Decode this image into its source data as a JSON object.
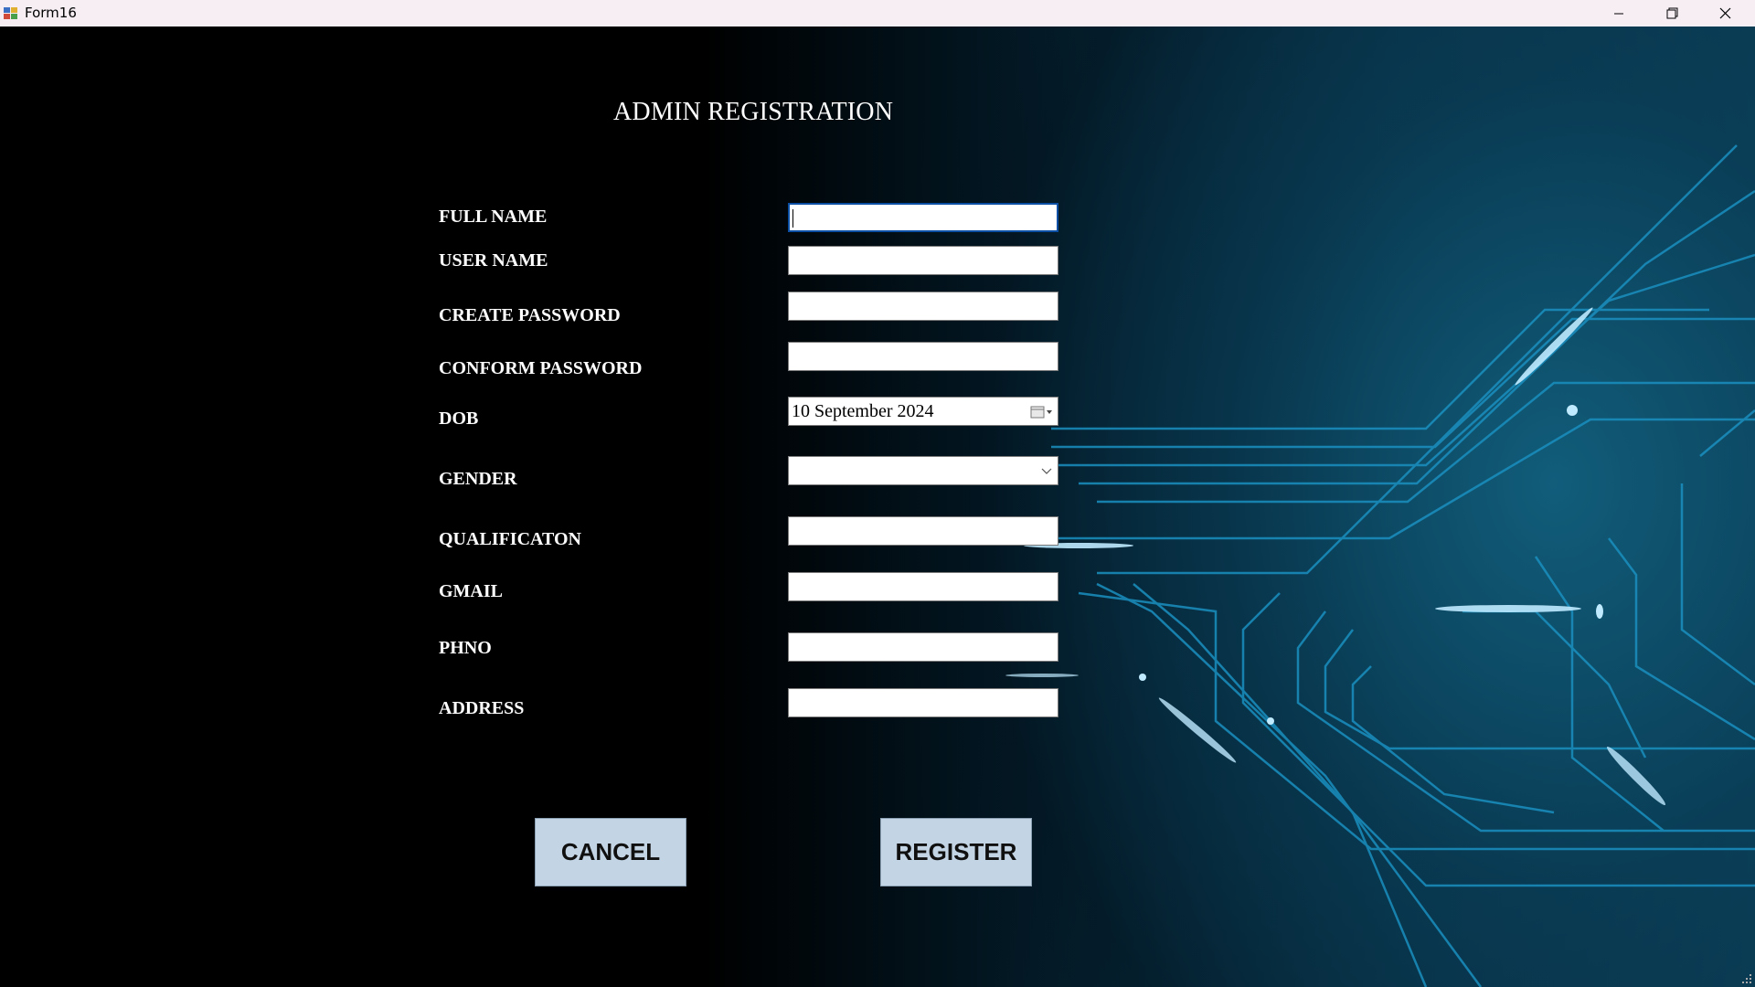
{
  "window": {
    "title": "Form16",
    "icon": "winforms-app-icon",
    "controls": [
      "minimize-icon",
      "restore-icon",
      "close-icon"
    ]
  },
  "form": {
    "heading": "ADMIN REGISTRATION",
    "fields": {
      "full_name": {
        "label": "FULL NAME",
        "value": ""
      },
      "user_name": {
        "label": "USER NAME",
        "value": ""
      },
      "create_password": {
        "label": "CREATE PASSWORD",
        "value": ""
      },
      "confirm_password": {
        "label": "CONFORM PASSWORD",
        "value": ""
      },
      "dob": {
        "label": "DOB",
        "value": "10 September 2024"
      },
      "gender": {
        "label": "GENDER",
        "value": ""
      },
      "qualification": {
        "label": "QUALIFICATON",
        "value": ""
      },
      "gmail": {
        "label": "GMAIL",
        "value": ""
      },
      "phno": {
        "label": "PHNO",
        "value": ""
      },
      "address": {
        "label": "ADDRESS",
        "value": ""
      }
    },
    "buttons": {
      "cancel": "CANCEL",
      "register": "REGISTER"
    }
  },
  "colors": {
    "titlebar_bg": "#f6eef3",
    "label_text": "#ffffff",
    "button_bg": "#c3d4e4",
    "focus_border": "#0a4fa3",
    "circuit_glow": "#1aa6d6"
  }
}
